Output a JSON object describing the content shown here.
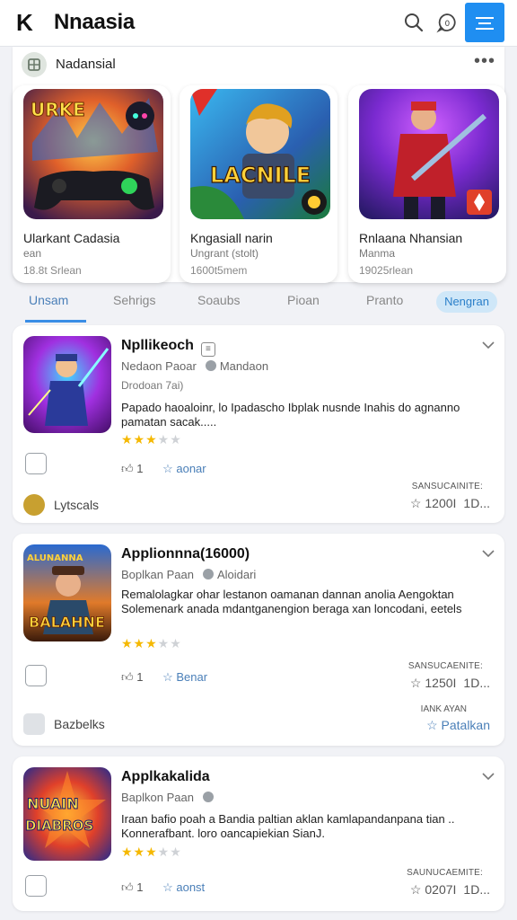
{
  "header": {
    "back_label": "K",
    "title": "Nnaasia"
  },
  "featured": {
    "title": "Nadansial",
    "more_label": "•••",
    "cards": [
      {
        "art_text": "URKE",
        "line1": "Ularkant Cadasia",
        "line2": "ean",
        "line3": "18.8t Srlean"
      },
      {
        "art_text": "LACNILE",
        "line1": "Kngasiall narin",
        "line2": "Ungrant (stolt)",
        "line3": "1600t5mem"
      },
      {
        "art_text": "",
        "line1": "Rnlaana Nhansian",
        "line2": "Manma",
        "line3": "19025rlean"
      }
    ]
  },
  "tabs": [
    "Unsam",
    "Sehrigs",
    "Soaubs",
    "Pioan",
    "Pranto",
    "Nengran"
  ],
  "apps": [
    {
      "name": "Npllikeoch",
      "publisher": "Nedaon Paoar",
      "category": "Mandaon",
      "meta": "Drodoan 7ai)",
      "description": "Papado haoaloinr, lo Ipadascho Ibplak nusnde Inahis do agnanno pamatan sacak.....",
      "rating": 3,
      "likes": "1",
      "action": "aonar",
      "stat_label": "SANSUCAINITE:",
      "stat_value": "1200I",
      "stat_big": "1D...",
      "tag": "Lytscals"
    },
    {
      "name": "Applionnna(16000)",
      "publisher": "Boplkan Paan",
      "category": "Aloidari",
      "description": "Remalolagkar ohar lestanon oamanan dannan anolia Aengoktan Solemenark anada mdantganengion beraga xan loncodani, eetels",
      "rating": 3,
      "likes": "1",
      "action": "Benar",
      "stat_label": "SANSUCAENITE:",
      "stat_value": "1250I",
      "stat_big": "1D...",
      "tag": "Bazbelks",
      "extra_label": "IANK AYAN",
      "extra_action": "Patalkan"
    },
    {
      "name": "Applkakalida",
      "publisher": "Baplkon Paan",
      "description": "Iraan bafio poah a Bandia paltian aklan kamlapandanpana tian .. Konnerafbant. loro oancapiekian SianJ.",
      "rating": 3,
      "likes": "1",
      "action": "aonst",
      "stat_label": "SAUNUCAEMITE:",
      "stat_value": "0207I",
      "stat_big": "1D..."
    }
  ]
}
